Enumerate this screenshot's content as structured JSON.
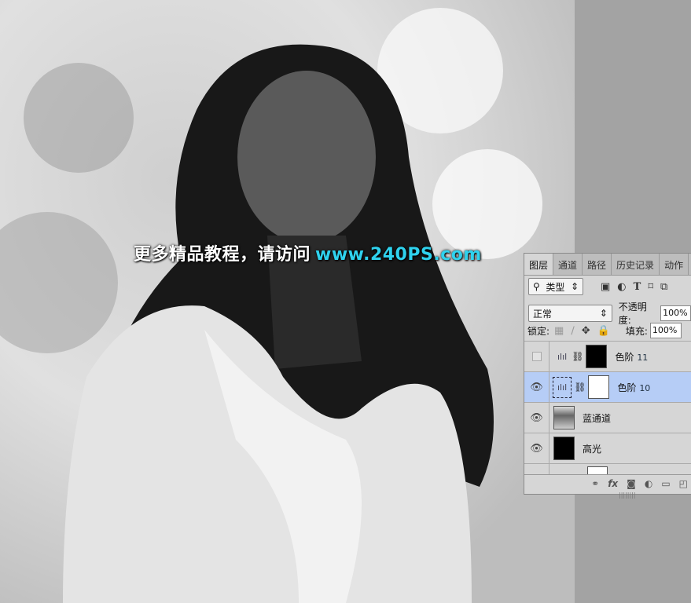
{
  "watermark": {
    "text": "更多精品教程，请访问",
    "url": "www.240PS.com"
  },
  "panel": {
    "tabs": [
      "图层",
      "通道",
      "路径",
      "历史记录",
      "动作"
    ],
    "filter": {
      "label": "类型",
      "icons": [
        "image-icon",
        "adjustment-icon",
        "type-icon",
        "shape-icon",
        "smart-object-icon"
      ]
    },
    "blend_mode": "正常",
    "opacity_label": "不透明度:",
    "opacity_value": "100%",
    "lock_label": "锁定:",
    "fill_label": "填充:",
    "fill_value": "100%",
    "layers": [
      {
        "name": "色阶",
        "num": "11",
        "visible": false,
        "selected": false
      },
      {
        "name": "色阶",
        "num": "10",
        "visible": true,
        "selected": true
      },
      {
        "name": "蓝通道",
        "visible": true,
        "selected": false
      },
      {
        "name": "高光",
        "visible": true,
        "selected": false
      }
    ]
  }
}
